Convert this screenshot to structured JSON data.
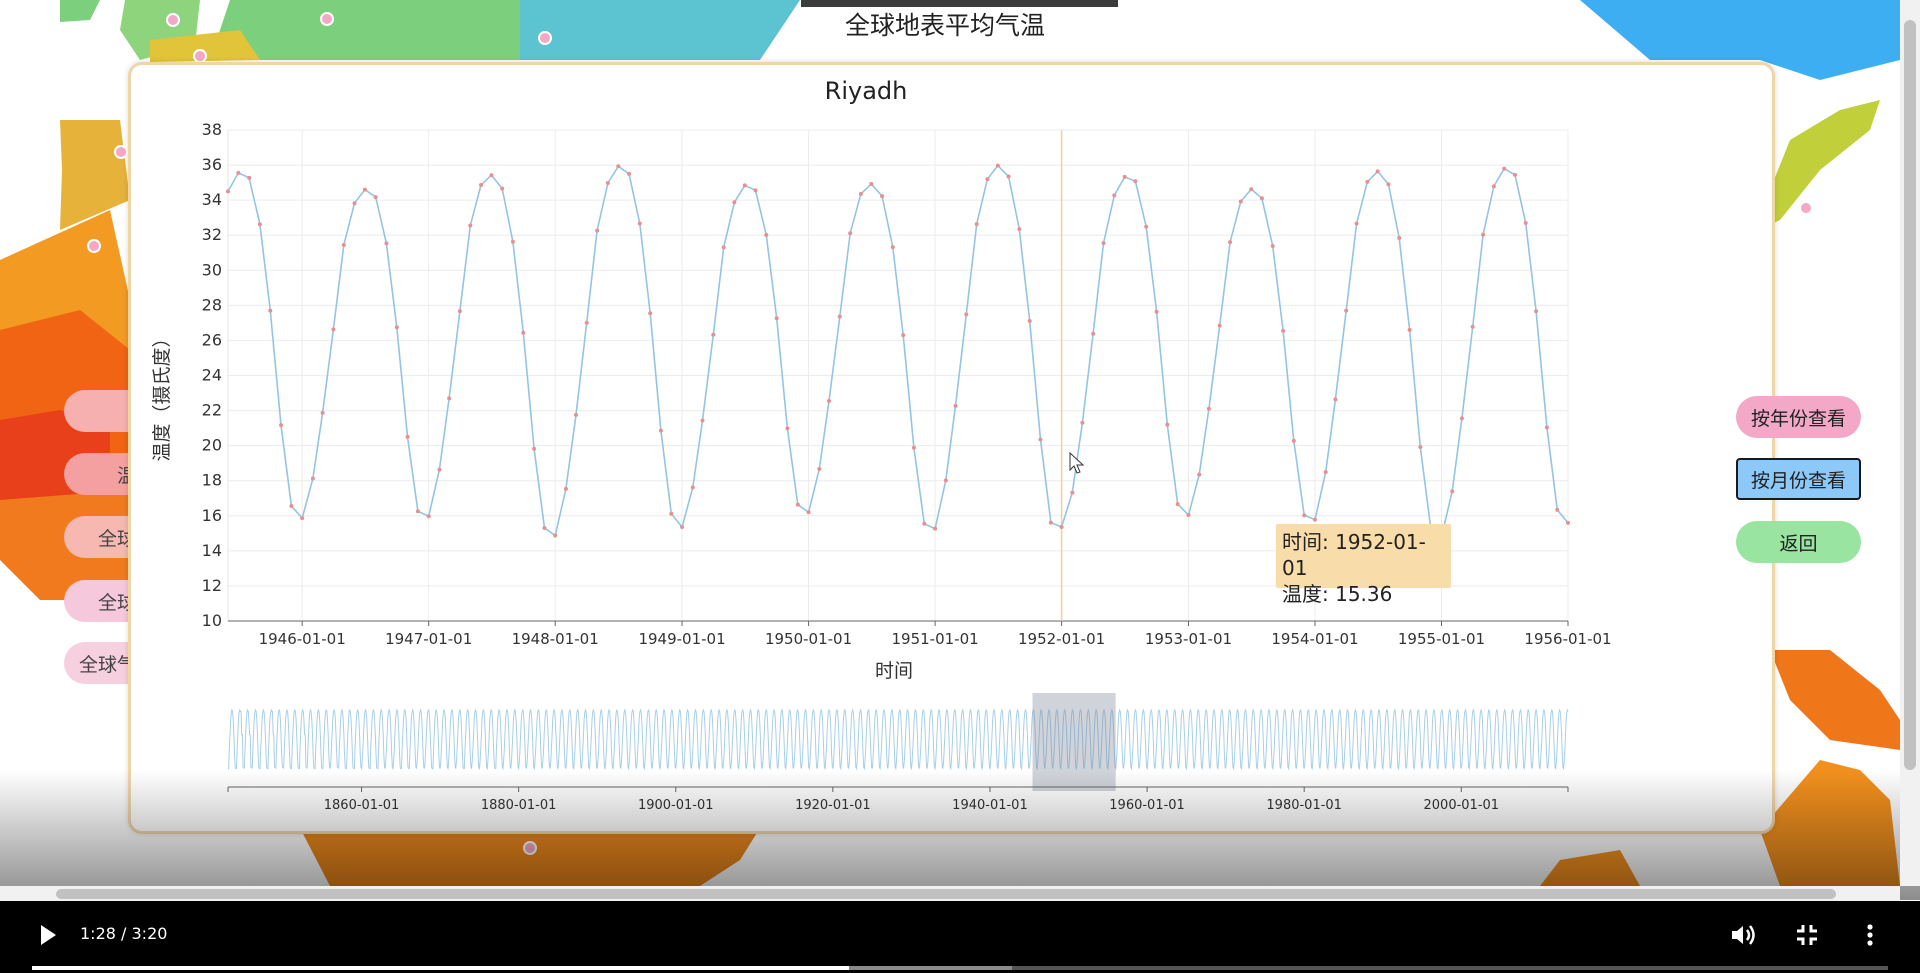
{
  "page": {
    "title": "全球地表平均气温"
  },
  "left_buttons": [
    "温",
    "全球",
    "全球",
    "全球气"
  ],
  "popup": {
    "buttons": {
      "by_year": "按年份查看",
      "by_month": "按月份查看",
      "back": "返回"
    },
    "tooltip": {
      "time": "时间: 1952-01-01",
      "temp": "温度: 15.36"
    }
  },
  "chart_data": {
    "type": "line",
    "title": "Riyadh",
    "xlabel": "时间",
    "ylabel": "温度（摄氏度）",
    "ylim": [
      10,
      38
    ],
    "yticks": [
      10,
      12,
      14,
      16,
      18,
      20,
      22,
      24,
      26,
      28,
      30,
      32,
      34,
      36,
      38
    ],
    "xticks": [
      "1946-01-01",
      "1947-01-01",
      "1948-01-01",
      "1949-01-01",
      "1950-01-01",
      "1951-01-01",
      "1952-01-01",
      "1953-01-01",
      "1954-01-01",
      "1955-01-01",
      "1956-01-01"
    ],
    "x_start": "1945-06-01",
    "x_end": "1956-01-01",
    "monthly_avg": [
      15.5,
      18.0,
      22.0,
      27.0,
      32.0,
      34.5,
      35.3,
      34.8,
      32.0,
      27.0,
      20.5,
      16.0
    ],
    "highlight": {
      "x": "1952-01-01",
      "y": 15.36
    },
    "grid": true,
    "overview": {
      "xticks": [
        "1860-01-01",
        "1880-01-01",
        "1900-01-01",
        "1920-01-01",
        "1940-01-01",
        "1960-01-01",
        "1980-01-01",
        "2000-01-01"
      ],
      "range": [
        "1843-01-01",
        "2013-08-01"
      ],
      "window": [
        "1945-06-01",
        "1956-01-01"
      ]
    }
  },
  "player": {
    "time": "1:28 / 3:20",
    "progress": 0.44
  },
  "colors": {
    "line": "#94c4e4",
    "points": "#e8908f",
    "cursor": "#f4cf98",
    "tooltip_bg": "#f8dcaa"
  }
}
